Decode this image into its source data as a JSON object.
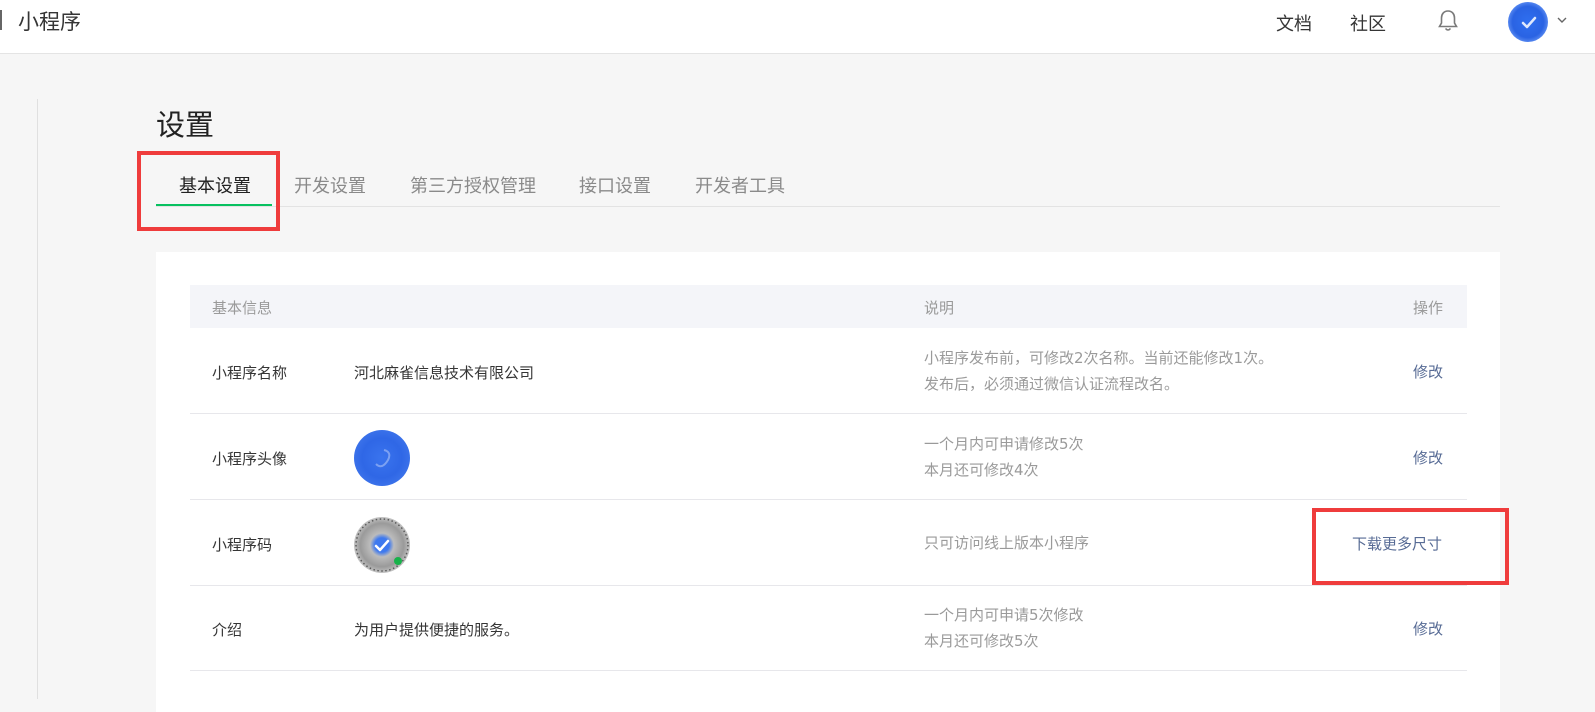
{
  "topbar": {
    "brand": "小程序",
    "nav": [
      "文档",
      "社区"
    ],
    "bell_icon": "bell-icon",
    "avatar_icon": "user-avatar",
    "caret_icon": "chevron-down-icon"
  },
  "page": {
    "title": "设置"
  },
  "tabs": [
    "基本设置",
    "开发设置",
    "第三方授权管理",
    "接口设置",
    "开发者工具"
  ],
  "active_tab": "基本设置",
  "table": {
    "headers": {
      "info": "基本信息",
      "desc": "说明",
      "action": "操作"
    },
    "rows": [
      {
        "label": "小程序名称",
        "value": "河北麻雀信息技术有限公司",
        "desc": [
          "小程序发布前，可修改2次名称。当前还能修改1次。",
          "发布后，必须通过微信认证流程改名。"
        ],
        "action": "修改"
      },
      {
        "label": "小程序头像",
        "value": "",
        "desc": [
          "一个月内可申请修改5次",
          "本月还可修改4次"
        ],
        "action": "修改"
      },
      {
        "label": "小程序码",
        "value": "",
        "desc": [
          "只可访问线上版本小程序"
        ],
        "action": "下载更多尺寸"
      },
      {
        "label": "介绍",
        "value": "为用户提供便捷的服务。",
        "desc": [
          "一个月内可申请5次修改",
          "本月还可修改5次"
        ],
        "action": "修改"
      }
    ]
  },
  "colors": {
    "accent_green": "#07c160",
    "link_blue": "#576b95",
    "highlight_red": "#ef3c3c"
  }
}
